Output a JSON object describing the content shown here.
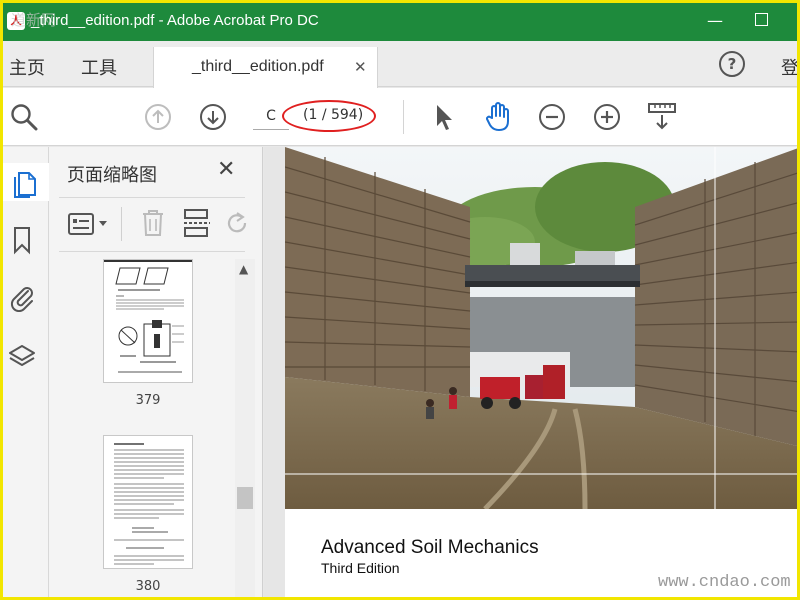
{
  "window": {
    "app_icon_text": "人",
    "watermark_logo": "道新网",
    "title": "_third__edition.pdf - Adobe Acrobat Pro DC",
    "minimize_glyph": "—"
  },
  "tabs": {
    "home": "主页",
    "tools": "工具",
    "document_tab": "_third__edition.pdf",
    "close_glyph": "✕",
    "help_glyph": "?",
    "sign_in": "登"
  },
  "toolbar": {
    "page_input": "C",
    "page_count": "(1 / 594)"
  },
  "thumbnail_panel": {
    "title": "页面缩略图",
    "close_glyph": "✕",
    "thumbnails": [
      {
        "label": "379"
      },
      {
        "label": "380"
      }
    ]
  },
  "document": {
    "book_title": "Advanced Soil Mechanics",
    "book_edition": "Third Edition"
  },
  "watermark": "www.cndao.com",
  "colors": {
    "titlebar": "#1e8a3c",
    "accent_blue": "#1b6fd1",
    "highlight_red": "#e02020",
    "frame_yellow": "#f2e600"
  }
}
